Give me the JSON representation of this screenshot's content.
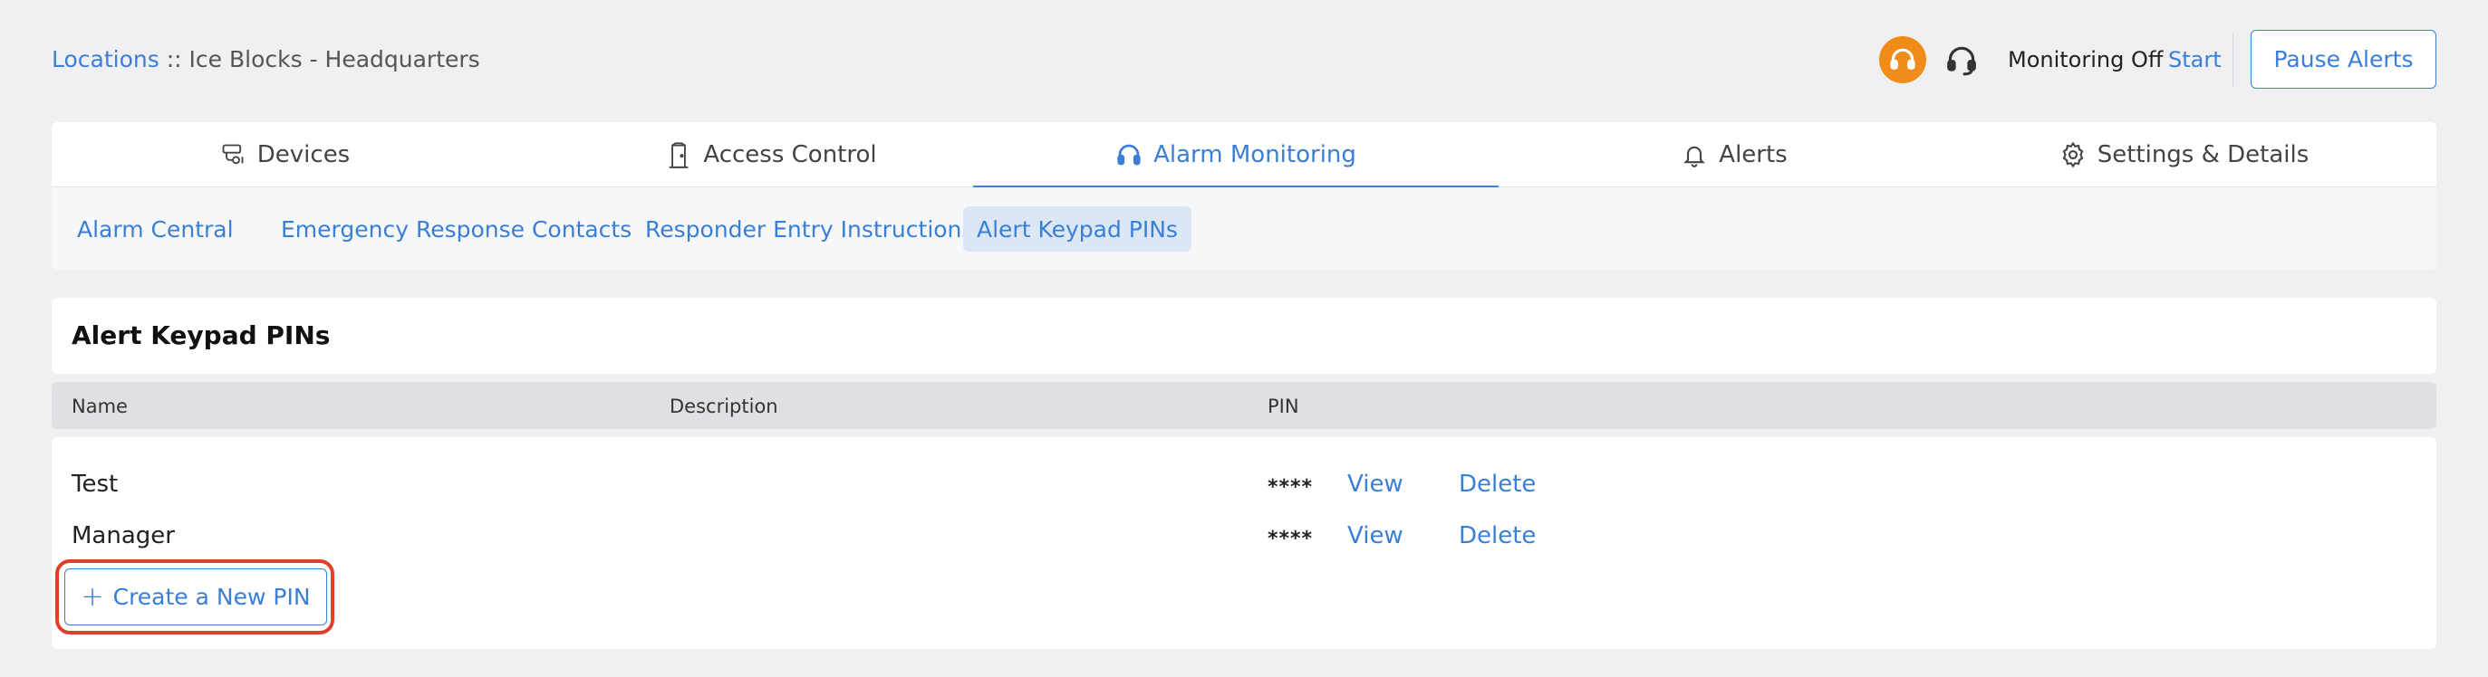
{
  "breadcrumb": {
    "root_label": "Locations",
    "separator": "::",
    "current": "Ice Blocks - Headquarters"
  },
  "header": {
    "monitoring_status": "Monitoring Off",
    "start_label": "Start",
    "pause_alerts_label": "Pause Alerts"
  },
  "main_tabs": [
    {
      "label": "Devices",
      "icon": "devices-icon",
      "active": false
    },
    {
      "label": "Access Control",
      "icon": "door-icon",
      "active": false
    },
    {
      "label": "Alarm Monitoring",
      "icon": "headset-icon",
      "active": true
    },
    {
      "label": "Alerts",
      "icon": "bell-icon",
      "active": false
    },
    {
      "label": "Settings & Details",
      "icon": "gear-icon",
      "active": false
    }
  ],
  "sub_tabs": [
    {
      "label": "Alarm Central",
      "active": false
    },
    {
      "label": "Emergency Response Contacts",
      "active": false
    },
    {
      "label": "Responder Entry Instructions",
      "active": false
    },
    {
      "label": "Alert Keypad PINs",
      "active": true
    }
  ],
  "section": {
    "title": "Alert Keypad PINs"
  },
  "table": {
    "columns": [
      "Name",
      "Description",
      "PIN"
    ],
    "rows": [
      {
        "name": "Test",
        "description": "",
        "pin": "****",
        "view_label": "View",
        "delete_label": "Delete"
      },
      {
        "name": "Manager",
        "description": "",
        "pin": "****",
        "view_label": "View",
        "delete_label": "Delete"
      }
    ]
  },
  "create_button": {
    "label": "Create a New PIN"
  },
  "colors": {
    "accent": "#3b7fd4",
    "monitor_badge": "#f08c1a",
    "highlight": "#e0402a",
    "page_bg": "#f0f0f3"
  }
}
